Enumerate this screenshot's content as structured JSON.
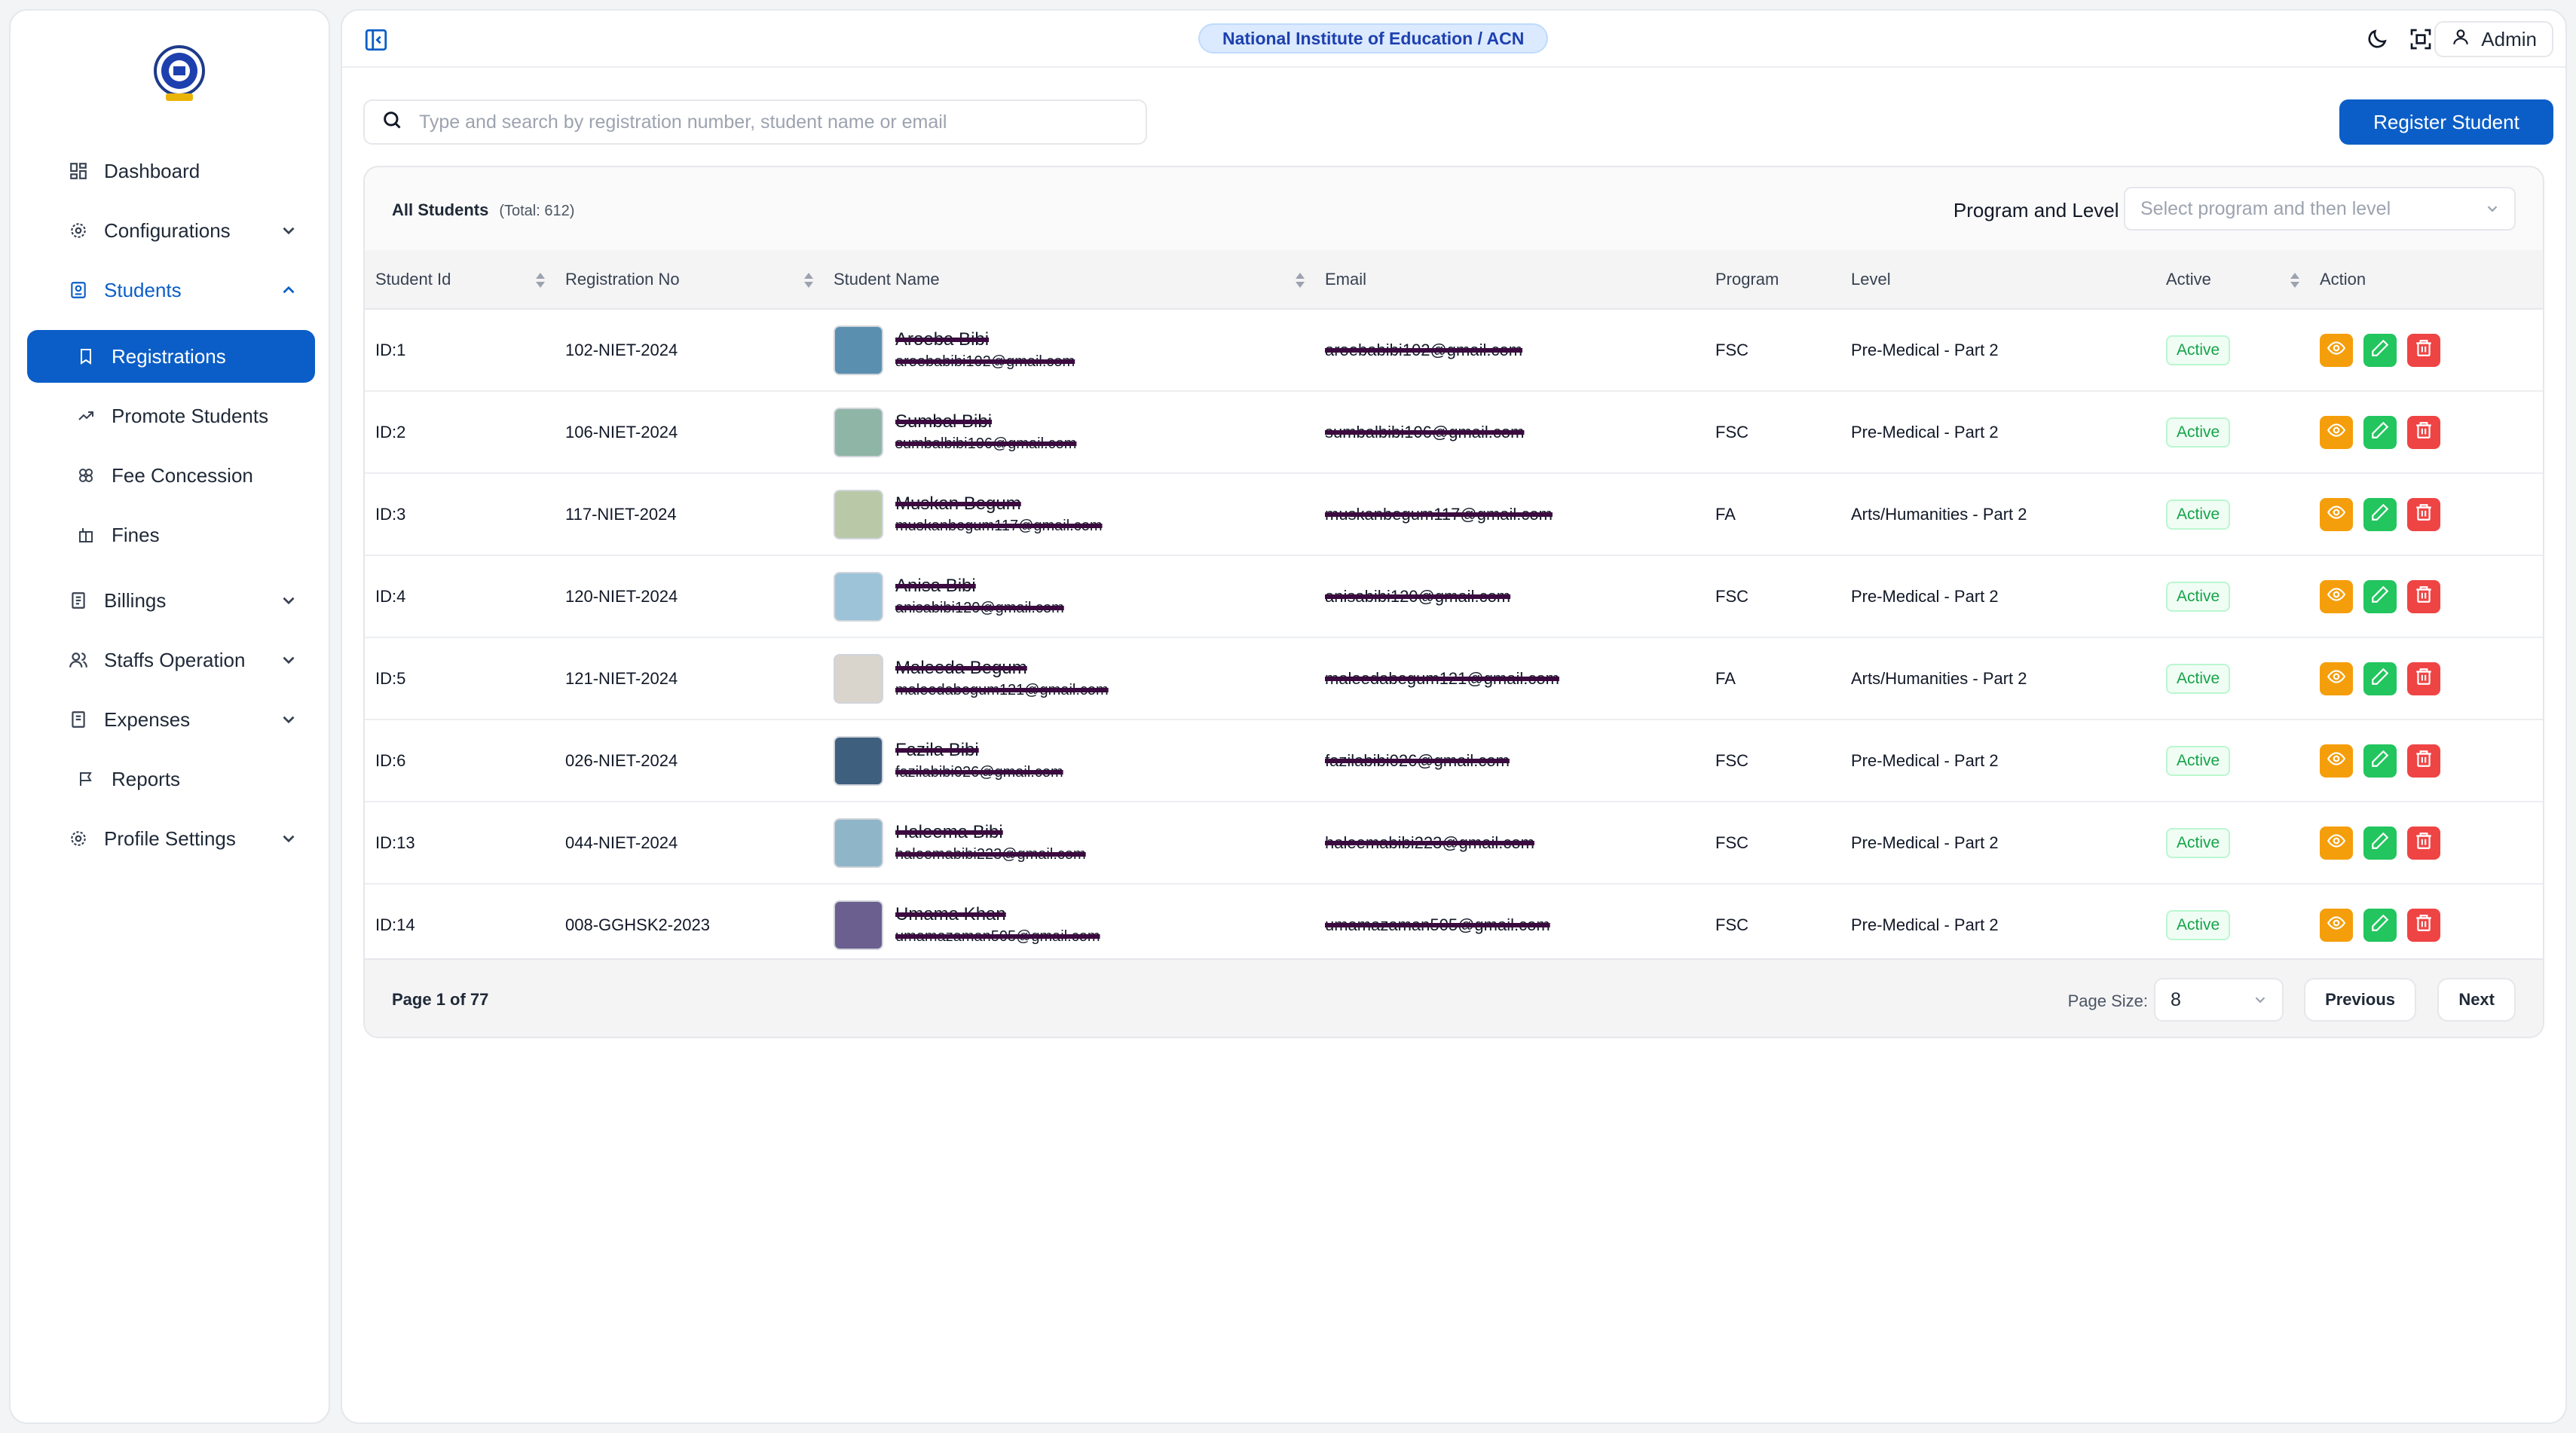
{
  "sidebar": {
    "logo": "institute-logo",
    "items": [
      {
        "label": "Dashboard",
        "icon": "dashboard-icon"
      },
      {
        "label": "Configurations",
        "icon": "gear-icon"
      },
      {
        "label": "Students",
        "icon": "student-icon"
      },
      {
        "label": "Registrations",
        "icon": "bookmark-icon"
      },
      {
        "label": "Promote Students",
        "icon": "trend-icon"
      },
      {
        "label": "Fee Concession",
        "icon": "concession-icon"
      },
      {
        "label": "Fines",
        "icon": "fines-icon"
      },
      {
        "label": "Billings",
        "icon": "billing-icon"
      },
      {
        "label": "Staffs Operation",
        "icon": "users-icon"
      },
      {
        "label": "Expenses",
        "icon": "expense-icon"
      },
      {
        "label": "Reports",
        "icon": "flag-icon"
      },
      {
        "label": "Profile Settings",
        "icon": "gear-icon"
      }
    ]
  },
  "header": {
    "institute": "National Institute of Education / ACN",
    "admin_label": "Admin"
  },
  "search": {
    "placeholder": "Type and search by registration number, student name or email",
    "value": ""
  },
  "register_label": "Register Student",
  "table": {
    "title": "All Students",
    "total": "(Total: 612)",
    "filter_label": "Program and Level :",
    "filter_placeholder": "Select program and then level",
    "columns": [
      "Student Id",
      "Registration No",
      "Student Name",
      "Email",
      "Program",
      "Level",
      "Active",
      "Action"
    ],
    "rows": [
      {
        "id": "ID:1",
        "reg": "102-NIET-2024",
        "name": "Aroeba Bibi",
        "mail": "aroebabibi102@gmail.com",
        "email": "aroebabibi102@gmail.com",
        "program": "FSC",
        "level": "Pre-Medical - Part 2",
        "status": "Active",
        "avatar_color": "#5b8fb0"
      },
      {
        "id": "ID:2",
        "reg": "106-NIET-2024",
        "name": "Sumbal Bibi",
        "mail": "sumbalbibi106@gmail.com",
        "email": "sumbalbibi106@gmail.com",
        "program": "FSC",
        "level": "Pre-Medical - Part 2",
        "status": "Active",
        "avatar_color": "#8fb5a7"
      },
      {
        "id": "ID:3",
        "reg": "117-NIET-2024",
        "name": "Muskan Begum",
        "mail": "muskanbegum117@gmail.com",
        "email": "muskanbegum117@gmail.com",
        "program": "FA",
        "level": "Arts/Humanities - Part 2",
        "status": "Active",
        "avatar_color": "#b9c9a8"
      },
      {
        "id": "ID:4",
        "reg": "120-NIET-2024",
        "name": "Anisa Bibi",
        "mail": "anisabibi120@gmail.com",
        "email": "anisabibi120@gmail.com",
        "program": "FSC",
        "level": "Pre-Medical - Part 2",
        "status": "Active",
        "avatar_color": "#9cc3d8"
      },
      {
        "id": "ID:5",
        "reg": "121-NIET-2024",
        "name": "Maleeda Begum",
        "mail": "maleedabegum121@gmail.com",
        "email": "maleedabegum121@gmail.com",
        "program": "FA",
        "level": "Arts/Humanities - Part 2",
        "status": "Active",
        "avatar_color": "#d9d4cc"
      },
      {
        "id": "ID:6",
        "reg": "026-NIET-2024",
        "name": "Fazila Bibi",
        "mail": "fazilabibi026@gmail.com",
        "email": "fazilabibi026@gmail.com",
        "program": "FSC",
        "level": "Pre-Medical - Part 2",
        "status": "Active",
        "avatar_color": "#3f5f7f"
      },
      {
        "id": "ID:13",
        "reg": "044-NIET-2024",
        "name": "Haleema Bibi",
        "mail": "haleemabibi223@gmail.com",
        "email": "haleemabibi223@gmail.com",
        "program": "FSC",
        "level": "Pre-Medical - Part 2",
        "status": "Active",
        "avatar_color": "#8fb6c8"
      },
      {
        "id": "ID:14",
        "reg": "008-GGHSK2-2023",
        "name": "Umama Khan",
        "mail": "umamazaman505@gmail.com",
        "email": "umamazaman505@gmail.com",
        "program": "FSC",
        "level": "Pre-Medical - Part 2",
        "status": "Active",
        "avatar_color": "#6a5f8f"
      }
    ]
  },
  "pagination": {
    "info": "Page 1 of 77",
    "size_label": "Page Size:",
    "size_value": "8",
    "prev": "Previous",
    "next": "Next"
  },
  "colors": {
    "primary": "#0b5ec7",
    "view": "#f59e0b",
    "edit": "#22c55e",
    "delete": "#ef4444"
  }
}
